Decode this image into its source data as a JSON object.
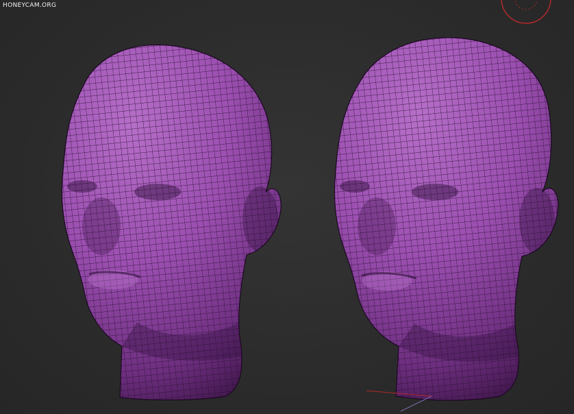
{
  "watermark": {
    "text": "HONEYCAM.ORG"
  },
  "viewport": {
    "background": "#2b2b2b",
    "models": [
      {
        "name": "head-model-left",
        "color": "#9b4fb0",
        "wire_color": "#2a0f33"
      },
      {
        "name": "head-model-right",
        "color": "#9b4fb0",
        "wire_color": "#2a0f33"
      }
    ],
    "icons": [
      "viewcube-compass-icon",
      "axis-gizmo-icon"
    ],
    "compass_color": "#b02a2a"
  }
}
